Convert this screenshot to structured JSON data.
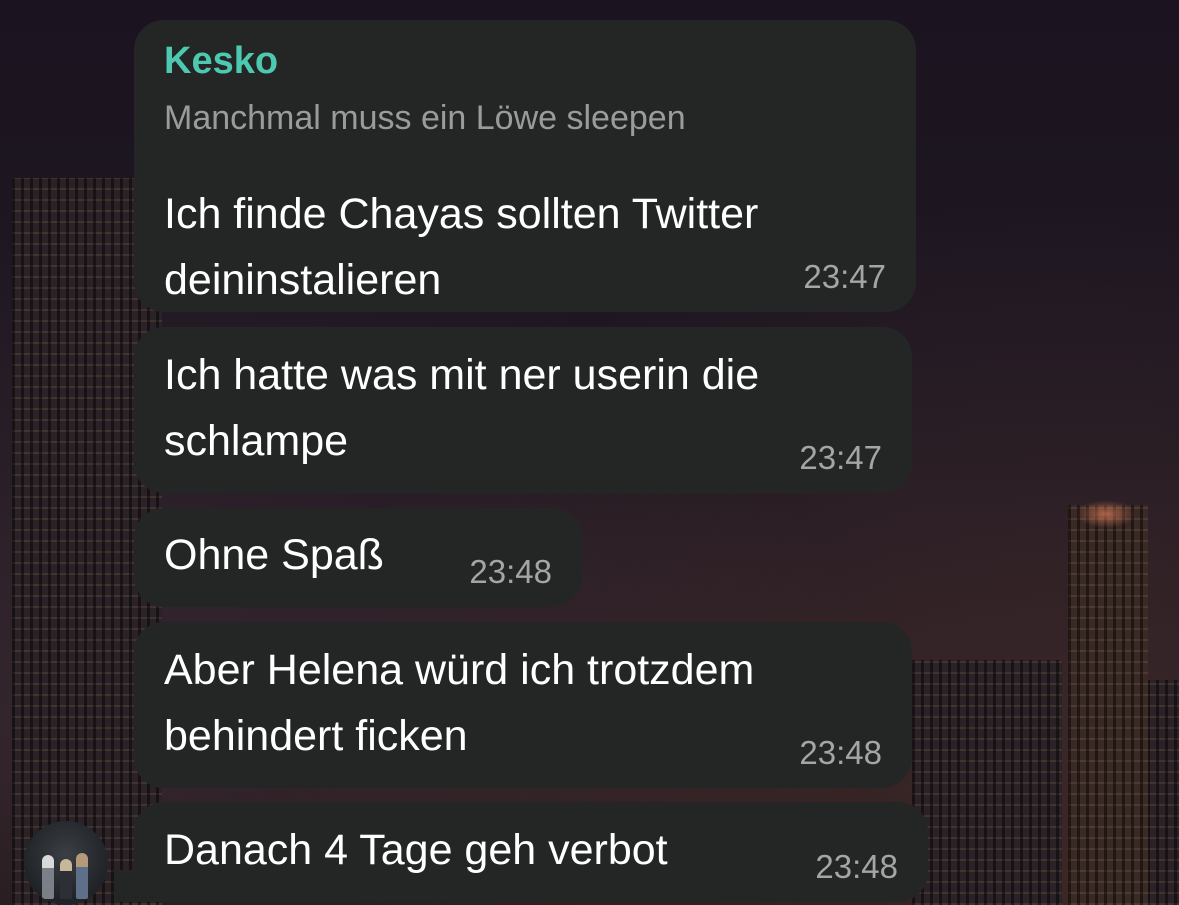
{
  "chat": {
    "sender_name": "Kesko",
    "sender_color": "#4cc9b0",
    "bubble_color": "#242626",
    "messages": [
      {
        "forward_line": "Manchmal muss ein Löwe sleepen",
        "lines": [
          "Ich finde Chayas sollten Twitter",
          "deininstalieren"
        ],
        "time": "23:47"
      },
      {
        "lines": [
          "Ich hatte was mit ner userin die",
          "schlampe"
        ],
        "time": "23:47"
      },
      {
        "lines": [
          "Ohne Spaß"
        ],
        "time": "23:48"
      },
      {
        "lines": [
          "Aber Helena würd ich trotzdem",
          "behindert ficken"
        ],
        "time": "23:48"
      },
      {
        "lines": [
          "Danach 4 Tage geh verbot"
        ],
        "time": "23:48"
      }
    ],
    "avatar_icon": "profile-photo"
  }
}
